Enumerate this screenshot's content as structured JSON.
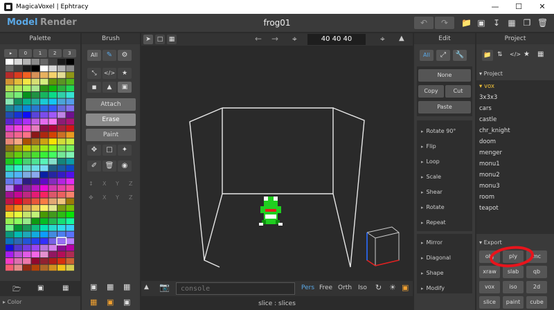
{
  "window": {
    "title": "MagicaVoxel | Ephtracy",
    "controls": [
      "—",
      "☐",
      "✕"
    ]
  },
  "topbar": {
    "modes": [
      "Model",
      "Render"
    ],
    "file_name": "frog01",
    "undo_icon": "undo-icon",
    "redo_icon": "redo-icon",
    "icons": [
      "open-folder-icon",
      "save-icon",
      "export-icon",
      "save-as-icon",
      "copy-icon",
      "delete-icon"
    ]
  },
  "palette": {
    "title": "Palette",
    "tabs": [
      "▸",
      "0",
      "1",
      "2",
      "3"
    ],
    "footer_label": "Color"
  },
  "brush": {
    "title": "Brush",
    "tabs": [
      "All"
    ],
    "modes": [
      "Attach",
      "Erase",
      "Paint"
    ],
    "axis_labels": [
      "X",
      "Y",
      "Z"
    ]
  },
  "viewport": {
    "dimensions": [
      "40",
      "40",
      "40"
    ],
    "console_placeholder": "console",
    "view_modes": [
      "Pers",
      "Free",
      "Orth",
      "Iso"
    ],
    "status": "slice : slices"
  },
  "edit": {
    "title": "Edit",
    "tabs": [
      "All"
    ],
    "buttons": [
      "None",
      "Copy",
      "Cut",
      "Paste"
    ],
    "menu": [
      "Rotate 90°",
      "Flip",
      "Loop",
      "Scale",
      "Shear",
      "Rotate",
      "Repeat",
      "Mirror",
      "Diagonal",
      "Shape",
      "Modify"
    ]
  },
  "project": {
    "title": "Project",
    "section": "Project",
    "items": [
      "vox",
      "3x3x3",
      "cars",
      "castle",
      "chr_knight",
      "doom",
      "menger",
      "monu1",
      "monu2",
      "monu3",
      "room",
      "teapot"
    ],
    "selected": "vox",
    "export_title": "Export",
    "export": [
      "obj",
      "ply",
      "mc",
      "xraw",
      "slab",
      "qb",
      "vox",
      "iso",
      "2d",
      "slice",
      "paint",
      "cube"
    ]
  },
  "colors": {
    "accent": "#5aa8e6",
    "selected_item": "#f0c23a",
    "annotation": "#e8141c"
  }
}
